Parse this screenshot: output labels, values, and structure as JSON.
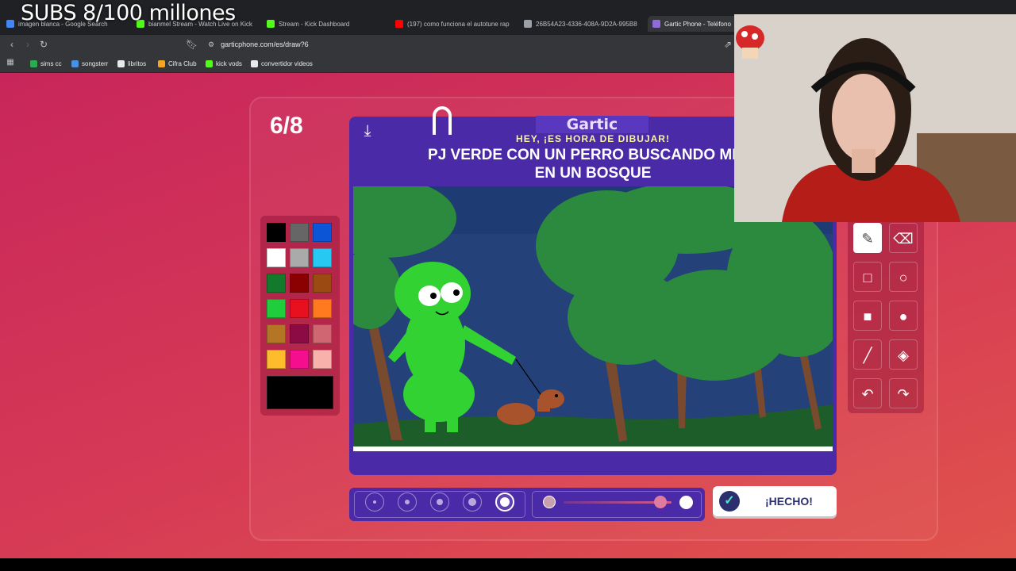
{
  "overlay": {
    "subs_text": "SUBS 8/100 millones"
  },
  "browser": {
    "tabs": [
      {
        "label": "imagen blanca - Google Search",
        "color": "#4285f4"
      },
      {
        "label": "bianmel Stream - Watch Live on Kick",
        "color": "#53fc18"
      },
      {
        "label": "Stream - Kick Dashboard",
        "color": "#53fc18"
      },
      {
        "label": "(197) como funciona el autotune rap",
        "color": "#ff0000"
      },
      {
        "label": "26B54A23-4336-408A-9D2A-995B8",
        "color": "#9aa0a6"
      },
      {
        "label": "Gartic Phone - Teléfono",
        "color": "#8e6bd8"
      }
    ],
    "url": "garticphone.com/es/draw?6",
    "bookmarks": [
      {
        "label": "sims cc",
        "color": "#2da94f"
      },
      {
        "label": "songsterr",
        "color": "#4a90e2"
      },
      {
        "label": "libritos",
        "color": "#e8eaed"
      },
      {
        "label": "Cifra Club",
        "color": "#f4a623"
      },
      {
        "label": "kick vods",
        "color": "#53fc18"
      },
      {
        "label": "convertidor videos",
        "color": "#e8eaed"
      }
    ]
  },
  "game": {
    "round": "6/8",
    "logo": "Gartic",
    "hint": "HEY, ¡ES HORA DE DIBUJAR!",
    "prompt_line1": "PJ VERDE CON UN PERRO BUSCANDO MINA",
    "prompt_line2": "EN UN BOSQUE",
    "done_label": "¡HECHO!",
    "palette": [
      "#000000",
      "#666666",
      "#0b55d6",
      "#ffffff",
      "#aaaaaa",
      "#27c8f2",
      "#147a2b",
      "#8b0000",
      "#9b4a12",
      "#1fce3c",
      "#e80f1f",
      "#ff7a1e",
      "#b47624",
      "#8c0b44",
      "#cf6671",
      "#fcbc2b",
      "#f50f8e",
      "#f9b1ac"
    ],
    "current_color": "#000000",
    "tools": [
      "pencil-icon",
      "eraser-icon",
      "square-outline-icon",
      "circle-outline-icon",
      "square-fill-icon",
      "circle-fill-icon",
      "line-icon",
      "fill-bucket-icon",
      "undo-icon",
      "redo-icon"
    ],
    "active_tool": "pencil-icon",
    "stroke_sizes": [
      1,
      2,
      3,
      4,
      5
    ],
    "active_stroke": 5,
    "opacity_level": 0.9
  }
}
